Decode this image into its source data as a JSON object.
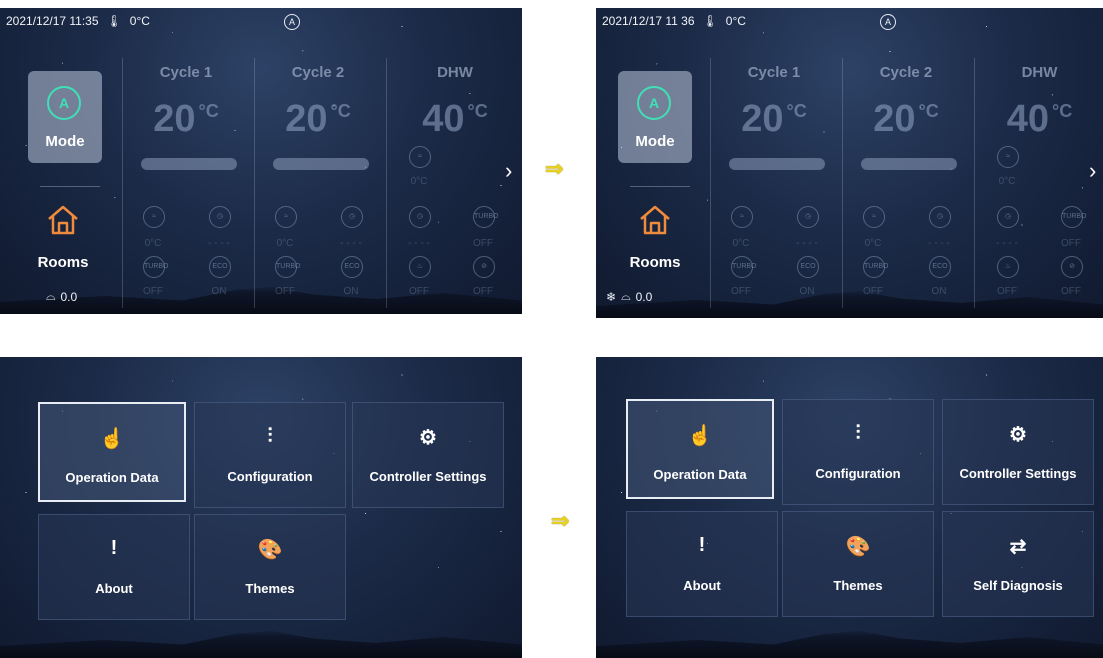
{
  "status_left": {
    "datetime": "2021/12/17 11:35",
    "outdoor_temp": "0°C",
    "auto_badge": "A"
  },
  "status_right": {
    "datetime": "2021/12/17 11 36",
    "outdoor_temp": "0°C",
    "auto_badge": "A"
  },
  "mode": {
    "icon_letter": "A",
    "label": "Mode"
  },
  "rooms": {
    "label": "Rooms"
  },
  "readout": "0.0",
  "columns": [
    {
      "title": "Cycle 1",
      "temp": "20",
      "unit": "°C",
      "sub_row1": [
        "0°C",
        "- - - -"
      ],
      "sub_row2": [
        "OFF",
        "ON"
      ]
    },
    {
      "title": "Cycle 2",
      "temp": "20",
      "unit": "°C",
      "sub_row1": [
        "0°C",
        "- - - -"
      ],
      "sub_row2": [
        "OFF",
        "ON"
      ]
    },
    {
      "title": "DHW",
      "temp": "40",
      "unit": "°C",
      "pump_value": "0°C",
      "sub_row1": [
        "- - - -",
        "OFF"
      ],
      "sub_row2": [
        "OFF",
        "OFF"
      ]
    }
  ],
  "icon_text": {
    "eco": "ECO",
    "boost": "TURBO"
  },
  "transition_arrow": "⇒",
  "menu_left": {
    "tiles": [
      {
        "label": "Operation Data",
        "icon": "hand-pointer-icon",
        "glyph": "☝",
        "selected": true
      },
      {
        "label": "Configuration",
        "icon": "sliders-icon",
        "glyph": "⫶",
        "selected": false
      },
      {
        "label": "Controller Settings",
        "icon": "gear-icon",
        "glyph": "⚙",
        "selected": false
      },
      {
        "label": "About",
        "icon": "exclamation-icon",
        "glyph": "!",
        "selected": false
      },
      {
        "label": "Themes",
        "icon": "palette-icon",
        "glyph": "🎨",
        "selected": false
      }
    ]
  },
  "menu_right": {
    "tiles": [
      {
        "label": "Operation Data",
        "icon": "hand-pointer-icon",
        "glyph": "☝",
        "selected": true
      },
      {
        "label": "Configuration",
        "icon": "sliders-icon",
        "glyph": "⫶",
        "selected": false
      },
      {
        "label": "Controller Settings",
        "icon": "gear-icon",
        "glyph": "⚙",
        "selected": false
      },
      {
        "label": "About",
        "icon": "exclamation-icon",
        "glyph": "!",
        "selected": false
      },
      {
        "label": "Themes",
        "icon": "palette-icon",
        "glyph": "🎨",
        "selected": false
      },
      {
        "label": "Self Diagnosis",
        "icon": "swap-arrows-icon",
        "glyph": "⇄",
        "selected": false
      }
    ]
  },
  "colors": {
    "accent": "#3fe0b8",
    "rooms_icon": "#f08a3c",
    "arrow": "#e8d21c"
  }
}
